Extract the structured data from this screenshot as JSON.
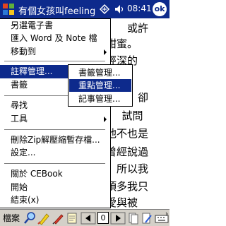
{
  "titlebar": {
    "title": "有個女孩叫feeling(上",
    "time": "08:41",
    "ok_label": "ok"
  },
  "document": {
    "lines": [
      "",
      "　　　　　　　　　壽？　或許",
      "　　　　　　　　　甜甜蜜。",
      "　　　　　　　　　憂經深的",
      "　　　　　　　　　，對他，",
      "　　　　　　　　　　管理，卻",
      "　　　　　　　　　歌。　試問",
      "　　　　　　　　　，他不也是",
      "　　　　　　　　　成曾經說過",
      "　　　　　　　　　人，所以我",
      "　　　　　　　　　，頂多我只",
      "　　　　　　　　　在愛與被"
    ]
  },
  "menu": {
    "items": [
      {
        "label": "另選電子書"
      },
      {
        "label": "匯入 Word 及 Note 檔"
      },
      {
        "label": "移動到"
      },
      {
        "label": "註釋管理..."
      },
      {
        "label": "書籤"
      },
      {
        "label": "尋找"
      },
      {
        "label": "工具"
      },
      {
        "label": "刪除Zip解壓縮暫存檔..."
      },
      {
        "label": "設定..."
      },
      {
        "label": "關於 CEBook"
      },
      {
        "label": "開始"
      },
      {
        "label": "結束(x)"
      }
    ]
  },
  "submenu": {
    "items": [
      {
        "label": "書籤管理..."
      },
      {
        "label": "重點管理..."
      },
      {
        "label": "記事管理..."
      }
    ]
  },
  "toolbar": {
    "menu_label": "檔案",
    "page_number": "0"
  }
}
